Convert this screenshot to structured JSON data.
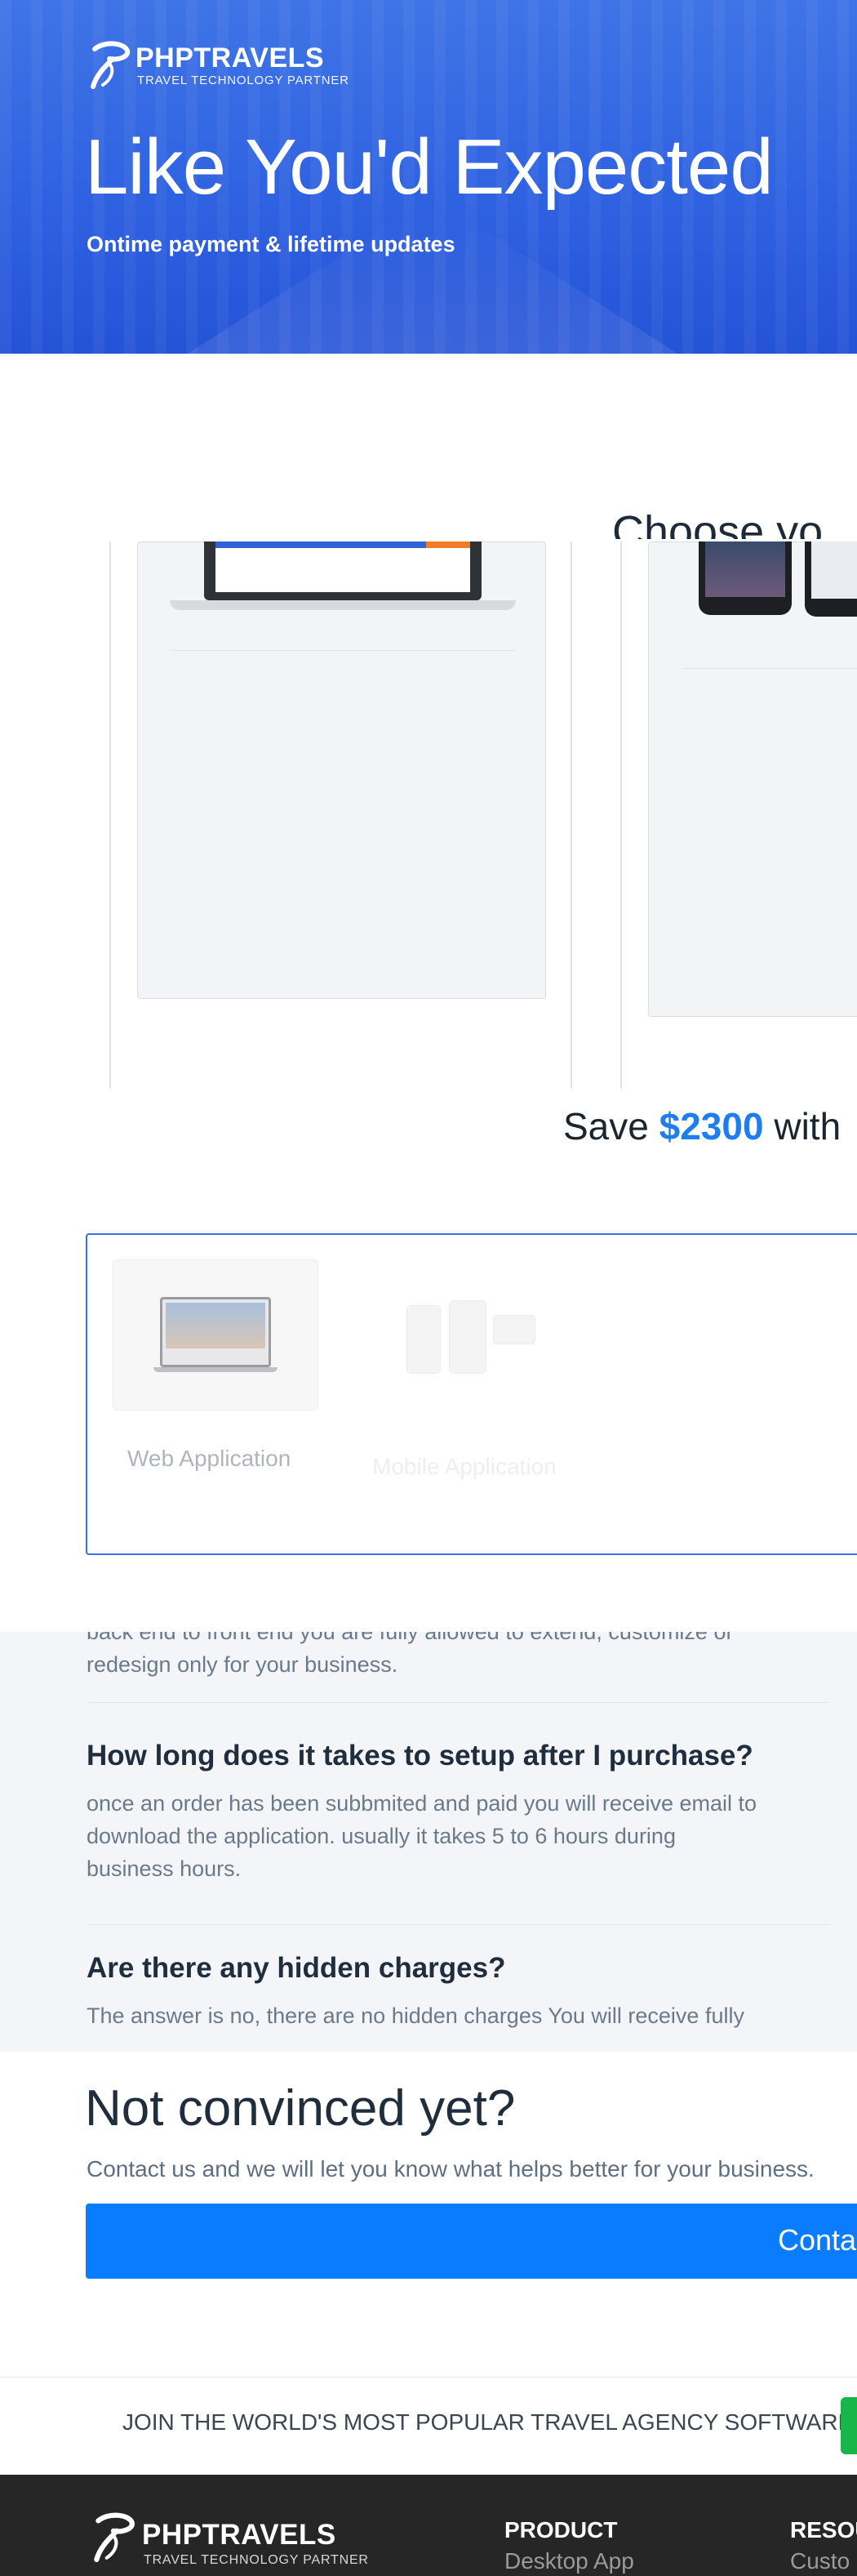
{
  "brand": {
    "name": "PHPTRAVELS",
    "tagline": "TRAVEL TECHNOLOGY PARTNER"
  },
  "hero": {
    "title": "Like You'd Expected",
    "subtitle": "Ontime payment & lifetime updates"
  },
  "choose": {
    "heading": "Choose yo"
  },
  "save": {
    "prefix": "Save ",
    "amount": "$2300",
    "suffix": " with"
  },
  "selector": {
    "web_label": "Web Application",
    "mobile_label": "Mobile Application"
  },
  "faq": {
    "partial_top": "back end to front end you are fully allowed to extend, customize or",
    "partial_top_2": "redesign only for your business.",
    "items": [
      {
        "question": "How long does it takes to setup after I purchase?",
        "answer_1": "once an order has been subbmited and paid you will receive email to",
        "answer_2": "download the application. usually it takes 5 to 6 hours during",
        "answer_3": "business hours."
      },
      {
        "question": "Are there any hidden charges?",
        "answer_1": "The answer is no, there are no hidden charges You will receive fully"
      }
    ]
  },
  "not_convinced": {
    "title": "Not convinced yet?",
    "subtitle": "Contact us and we will let you know what helps better for your business.",
    "button": "Conta"
  },
  "join": {
    "text": "JOIN THE WORLD'S MOST POPULAR TRAVEL AGENCY SOFTWARE"
  },
  "footer": {
    "product_title": "PRODUCT",
    "product_item": "Desktop App",
    "resources_title": "RESOU",
    "resources_item": "Custo"
  },
  "colors": {
    "hero_blue": "#2f62e1",
    "accent_blue": "#1e7ef0",
    "button_blue": "#0a7cff",
    "join_green": "#17b54a",
    "footer_bg": "#262626"
  }
}
